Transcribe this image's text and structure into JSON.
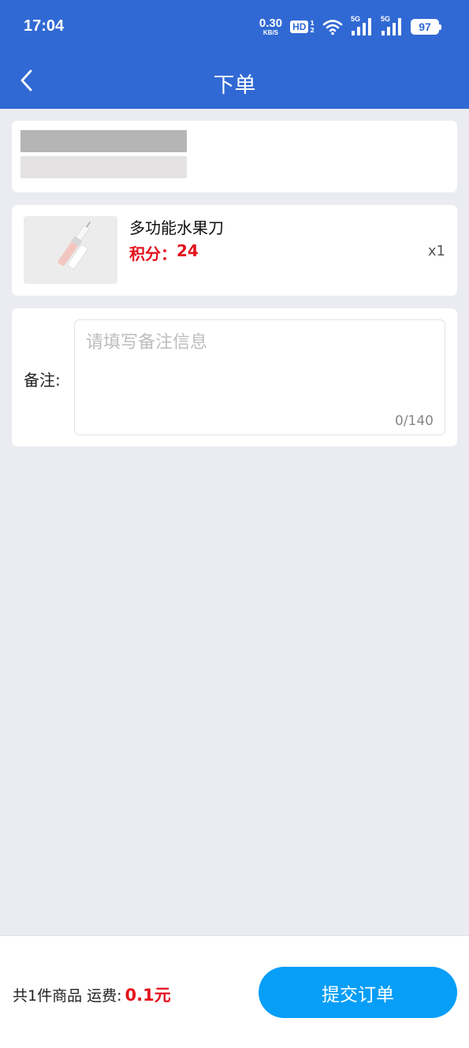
{
  "status_bar": {
    "time": "17:04",
    "net_speed_value": "0.30",
    "net_speed_unit": "KB/S",
    "hd_label": "HD",
    "hd_sub_top": "1",
    "hd_sub_bottom": "2",
    "signal1_tag": "5G",
    "signal2_tag": "5G",
    "battery": "97"
  },
  "header": {
    "title": "下单",
    "color": "#3169d4"
  },
  "product": {
    "name": "多功能水果刀",
    "points_label": "积分：",
    "points_value": "24",
    "quantity": "x1"
  },
  "remark": {
    "label": "备注:",
    "placeholder": "请填写备注信息",
    "counter": "0/140"
  },
  "footer": {
    "summary": "共1件商品 运费:",
    "shipping_fee": "0.1元",
    "submit_label": "提交订单",
    "accent_color": "#079ef7",
    "price_color": "#e4121c"
  }
}
